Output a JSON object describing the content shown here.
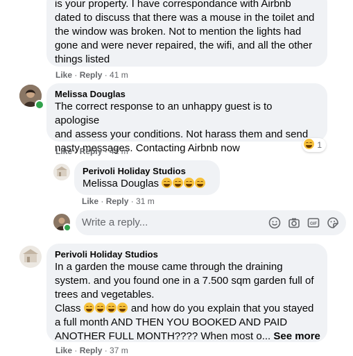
{
  "comments": [
    {
      "id": "c1",
      "partial_top_line": "is your property. I have correspondance with Airbnb",
      "lines": [
        "dated to discuss that there was a mouse in the toilet and",
        "the window was broken. Not to mention the lights had",
        "gone and were never repaired, the wifi, and all the other",
        "things listed"
      ],
      "like": "Like",
      "reply": "Reply",
      "time": "41 m"
    },
    {
      "id": "c2",
      "author": "Melissa Douglas",
      "lines": [
        "The correct response to an unhappy guest is to apologise",
        "and assess your conditions. Not harass them and send",
        "nasty messages. Contacting Airbnb now"
      ],
      "like": "Like",
      "reply": "Reply",
      "time": "41 m",
      "reaction_count": "1"
    },
    {
      "id": "c3",
      "author": "Perivoli Holiday Studios",
      "mention": "Melissa Douglas",
      "like": "Like",
      "reply": "Reply",
      "time": "31 m"
    },
    {
      "id": "c4",
      "author": "Perivoli Holiday Studios",
      "lines": [
        "In a garden the mouse came through the draining",
        "system. and you found one in a 7.500 sqm garden full of",
        "trees and vegetables.",
        "Class",
        " and how do you explain that you stayed",
        "a full month AND THEN YOU BOOKED AND PAID",
        "ANOTHER FULL MONTH???? When most o... "
      ],
      "see_more": "See more",
      "like": "Like",
      "reply": "Reply",
      "time": "37 m"
    }
  ],
  "reply_box": {
    "placeholder": "Write a reply...",
    "tools": [
      "emoji-icon",
      "camera-icon",
      "gif-icon",
      "sticker-icon"
    ]
  },
  "colors": {
    "bubble": "#f0f2f5",
    "meta": "#65676b",
    "online": "#31a24c"
  }
}
